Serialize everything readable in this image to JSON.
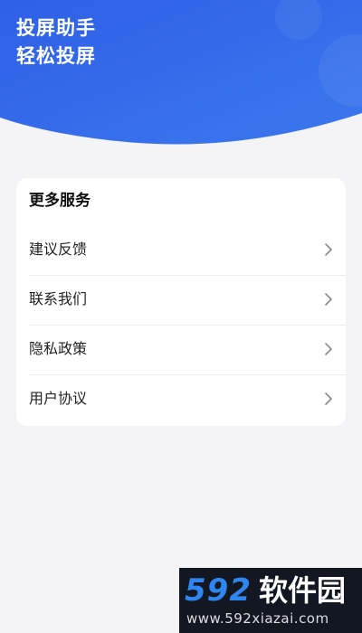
{
  "header": {
    "title": "投屏助手",
    "subtitle": "轻松投屏"
  },
  "services": {
    "title": "更多服务",
    "items": [
      {
        "label": "建议反馈",
        "icon": "chevron-right-icon"
      },
      {
        "label": "联系我们",
        "icon": "chevron-right-icon"
      },
      {
        "label": "隐私政策",
        "icon": "chevron-right-icon"
      },
      {
        "label": "用户协议",
        "icon": "chevron-right-icon"
      }
    ]
  },
  "watermark": {
    "number": "592",
    "name": "软件园",
    "url": "www.592xiazai.com"
  },
  "colors": {
    "header_blue": "#3268ea",
    "background": "#f4f4f6",
    "card": "#ffffff",
    "chevron": "#8a8a8a",
    "watermark_bg": "#121722",
    "watermark_blue": "#2f86f0"
  }
}
